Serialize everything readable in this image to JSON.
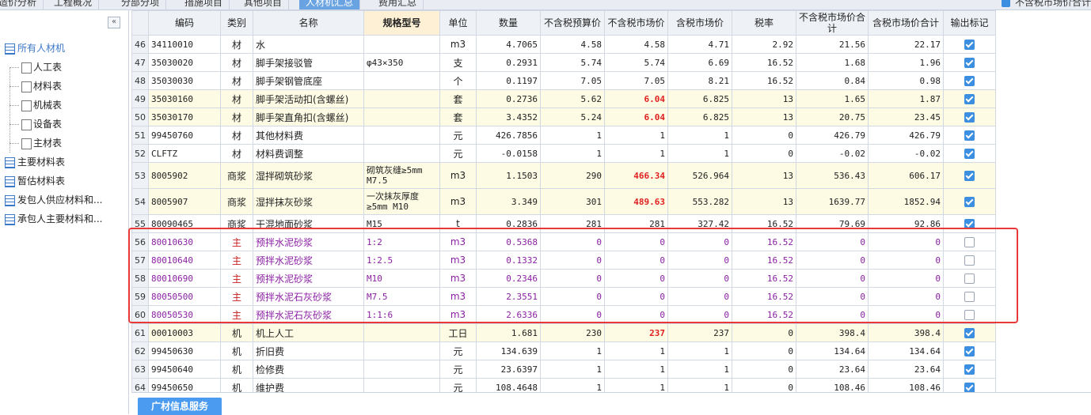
{
  "tabs": [
    "造价分析",
    "工程概况",
    "分部分项",
    "措施项目",
    "其他项目",
    "人材机汇总",
    "费用汇总"
  ],
  "active_tab_index": 5,
  "top_right_checkbox_label": "不含税市场价合计",
  "sidebar": {
    "collapse_label": "«",
    "items": [
      {
        "label": "所有人材机",
        "level": "root"
      },
      {
        "label": "人工表",
        "level": "child"
      },
      {
        "label": "材料表",
        "level": "child"
      },
      {
        "label": "机械表",
        "level": "child"
      },
      {
        "label": "设备表",
        "level": "child"
      },
      {
        "label": "主材表",
        "level": "child"
      },
      {
        "label": "主要材料表",
        "level": "top"
      },
      {
        "label": "暂估材料表",
        "level": "top"
      },
      {
        "label": "发包人供应材料和...",
        "level": "top"
      },
      {
        "label": "承包人主要材料和...",
        "level": "top"
      }
    ]
  },
  "table": {
    "headers": [
      "",
      "编码",
      "类别",
      "名称",
      "规格型号",
      "单位",
      "数量",
      "不含税预算价",
      "不含税市场价",
      "含税市场价",
      "税率",
      "不含税市场价合计",
      "含税市场价合计",
      "输出标记"
    ],
    "rows": [
      {
        "n": "46",
        "code": "34110010",
        "type": "材",
        "name": "水",
        "spec": "",
        "unit": "m3",
        "qty": "4.7065",
        "budget": "4.58",
        "market": "4.58",
        "taxed": "4.71",
        "rate": "2.92",
        "sum": "21.56",
        "taxsum": "22.17",
        "out": true
      },
      {
        "n": "47",
        "code": "35030020",
        "type": "材",
        "name": "脚手架接驳管",
        "spec": "φ43×350",
        "unit": "支",
        "qty": "0.2931",
        "budget": "5.74",
        "market": "5.74",
        "taxed": "6.69",
        "rate": "16.52",
        "sum": "1.68",
        "taxsum": "1.96",
        "out": true
      },
      {
        "n": "48",
        "code": "35030030",
        "type": "材",
        "name": "脚手架钢管底座",
        "spec": "",
        "unit": "个",
        "qty": "0.1197",
        "budget": "7.05",
        "market": "7.05",
        "taxed": "8.21",
        "rate": "16.52",
        "sum": "0.84",
        "taxsum": "0.98",
        "out": true
      },
      {
        "n": "49",
        "code": "35030160",
        "type": "材",
        "name": "脚手架活动扣(含螺丝)",
        "spec": "",
        "unit": "套",
        "qty": "0.2736",
        "budget": "5.62",
        "market": "6.04",
        "taxed": "6.825",
        "rate": "13",
        "sum": "1.65",
        "taxsum": "1.87",
        "out": true,
        "yellow": true,
        "redmarket": true
      },
      {
        "n": "50",
        "code": "35030170",
        "type": "材",
        "name": "脚手架直角扣(含螺丝)",
        "spec": "",
        "unit": "套",
        "qty": "3.4352",
        "budget": "5.24",
        "market": "6.04",
        "taxed": "6.825",
        "rate": "13",
        "sum": "20.75",
        "taxsum": "23.45",
        "out": true,
        "yellow": true,
        "redmarket": true
      },
      {
        "n": "51",
        "code": "99450760",
        "type": "材",
        "name": "其他材料费",
        "spec": "",
        "unit": "元",
        "qty": "426.7856",
        "budget": "1",
        "market": "1",
        "taxed": "1",
        "rate": "0",
        "sum": "426.79",
        "taxsum": "426.79",
        "out": true
      },
      {
        "n": "52",
        "code": "CLFTZ",
        "type": "材",
        "name": "材料费调整",
        "spec": "",
        "unit": "元",
        "qty": "-0.0158",
        "budget": "1",
        "market": "1",
        "taxed": "1",
        "rate": "0",
        "sum": "-0.02",
        "taxsum": "-0.02",
        "out": true
      },
      {
        "n": "53",
        "code": "8005902",
        "type": "商浆",
        "name": "湿拌砌筑砂浆",
        "spec": "砌筑灰缝≥5mm M7.5",
        "unit": "m3",
        "qty": "1.1503",
        "budget": "290",
        "market": "466.34",
        "taxed": "526.964",
        "rate": "13",
        "sum": "536.43",
        "taxsum": "606.17",
        "out": true,
        "yellow": true,
        "redmarket": true,
        "tall": true
      },
      {
        "n": "54",
        "code": "8005907",
        "type": "商浆",
        "name": "湿拌抹灰砂浆",
        "spec": "一次抹灰厚度≥5mm M10",
        "unit": "m3",
        "qty": "3.349",
        "budget": "301",
        "market": "489.63",
        "taxed": "553.282",
        "rate": "13",
        "sum": "1639.77",
        "taxsum": "1852.94",
        "out": true,
        "yellow": true,
        "redmarket": true,
        "tall": true
      },
      {
        "n": "55",
        "code": "80090465",
        "type": "商浆",
        "name": "干混地面砂浆",
        "spec": "M15",
        "unit": "t",
        "qty": "0.2836",
        "budget": "281",
        "market": "281",
        "taxed": "327.42",
        "rate": "16.52",
        "sum": "79.69",
        "taxsum": "92.86",
        "out": true
      },
      {
        "n": "56",
        "code": "80010630",
        "type": "主",
        "name": "预拌水泥砂浆",
        "spec": "1:2",
        "unit": "m3",
        "qty": "0.5368",
        "budget": "0",
        "market": "0",
        "taxed": "0",
        "rate": "16.52",
        "sum": "0",
        "taxsum": "0",
        "out": false,
        "purple": true
      },
      {
        "n": "57",
        "code": "80010640",
        "type": "主",
        "name": "预拌水泥砂浆",
        "spec": "1:2.5",
        "unit": "m3",
        "qty": "0.1332",
        "budget": "0",
        "market": "0",
        "taxed": "0",
        "rate": "16.52",
        "sum": "0",
        "taxsum": "0",
        "out": false,
        "purple": true
      },
      {
        "n": "58",
        "code": "80010690",
        "type": "主",
        "name": "预拌水泥砂浆",
        "spec": "M10",
        "unit": "m3",
        "qty": "0.2346",
        "budget": "0",
        "market": "0",
        "taxed": "0",
        "rate": "16.52",
        "sum": "0",
        "taxsum": "0",
        "out": false,
        "purple": true
      },
      {
        "n": "59",
        "code": "80050500",
        "type": "主",
        "name": "预拌水泥石灰砂浆",
        "spec": "M7.5",
        "unit": "m3",
        "qty": "2.3551",
        "budget": "0",
        "market": "0",
        "taxed": "0",
        "rate": "16.52",
        "sum": "0",
        "taxsum": "0",
        "out": false,
        "purple": true
      },
      {
        "n": "60",
        "code": "80050530",
        "type": "主",
        "name": "预拌水泥石灰砂浆",
        "spec": "1:1:6",
        "unit": "m3",
        "qty": "2.6336",
        "budget": "0",
        "market": "0",
        "taxed": "0",
        "rate": "16.52",
        "sum": "0",
        "taxsum": "0",
        "out": false,
        "purple": true
      },
      {
        "n": "61",
        "code": "00010003",
        "type": "机",
        "name": "机上人工",
        "spec": "",
        "unit": "工日",
        "qty": "1.681",
        "budget": "230",
        "market": "237",
        "taxed": "237",
        "rate": "0",
        "sum": "398.4",
        "taxsum": "398.4",
        "out": true,
        "yellow": true,
        "redmarket": true
      },
      {
        "n": "62",
        "code": "99450630",
        "type": "机",
        "name": "折旧费",
        "spec": "",
        "unit": "元",
        "qty": "134.639",
        "budget": "1",
        "market": "1",
        "taxed": "1",
        "rate": "0",
        "sum": "134.64",
        "taxsum": "134.64",
        "out": true
      },
      {
        "n": "63",
        "code": "99450640",
        "type": "机",
        "name": "检修费",
        "spec": "",
        "unit": "元",
        "qty": "23.6397",
        "budget": "1",
        "market": "1",
        "taxed": "1",
        "rate": "0",
        "sum": "23.64",
        "taxsum": "23.64",
        "out": true
      },
      {
        "n": "64",
        "code": "99450650",
        "type": "机",
        "name": "维护费",
        "spec": "",
        "unit": "元",
        "qty": "108.4648",
        "budget": "1",
        "market": "1",
        "taxed": "1",
        "rate": "0",
        "sum": "108.46",
        "taxsum": "108.46",
        "out": true
      }
    ]
  },
  "bottom": {
    "service_button": "广材信息服务"
  },
  "colors": {
    "accent": "#3c8fe0",
    "highlight_frame": "#e8393a",
    "red_value": "#e02020",
    "main_material": "#8b1fa3",
    "yellow_row": "#fdfbe3"
  }
}
